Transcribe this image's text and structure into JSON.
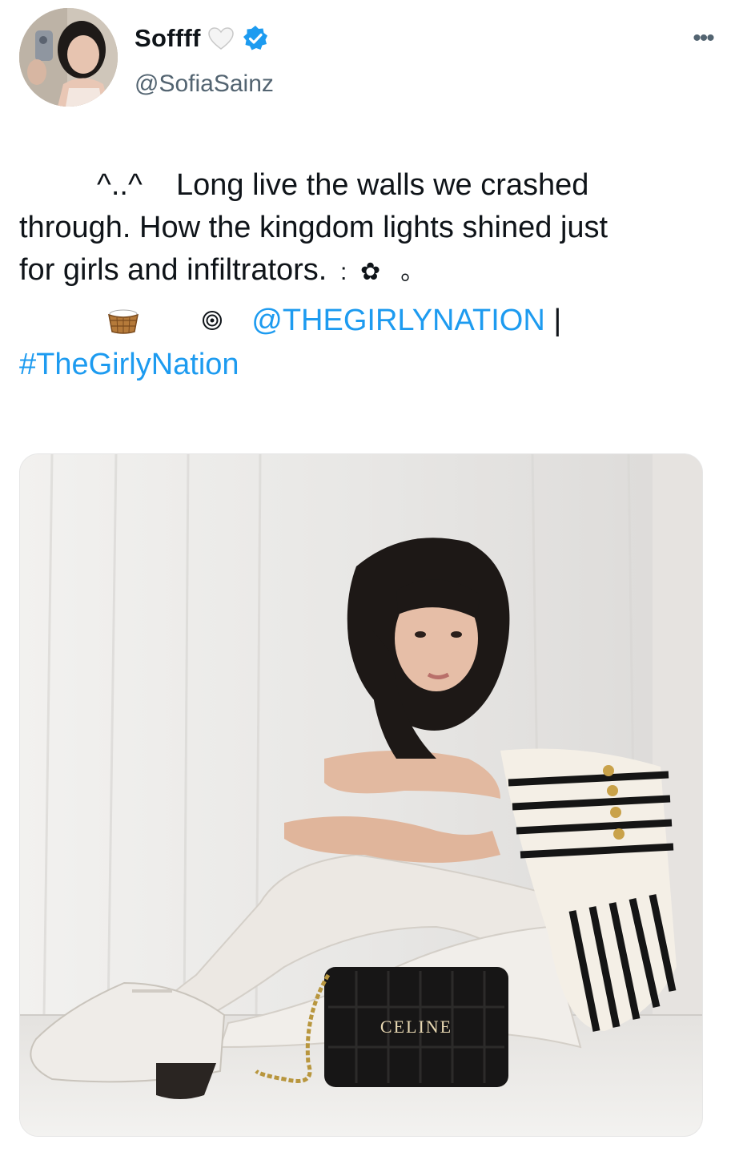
{
  "author": {
    "display_name": "Soffff",
    "handle": "@SofiaSainz",
    "heart_icon": "white-heart-icon",
    "verified_icon": "verified-badge-icon",
    "verified_color": "#1d9bf0"
  },
  "more_menu": {
    "label": "•••",
    "icon": "more-options-icon"
  },
  "tweet": {
    "line1": "^..^    Long live the walls we crashed",
    "line2": "through. How the kingdom lights shined just",
    "line3_text": "for girls and infiltrators.",
    "line3_deco": "  :  ✿   。",
    "mention": "@THEGIRLYNATION",
    "separator": " |",
    "hashtag": "#TheGirlyNation",
    "link_color": "#1d9bf0"
  },
  "media": {
    "bag_brand": "CELINE"
  }
}
